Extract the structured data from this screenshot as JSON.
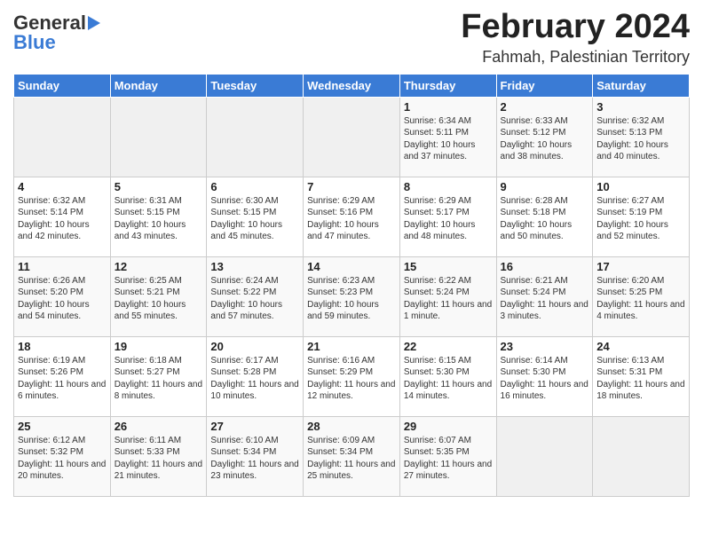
{
  "header": {
    "logo_general": "General",
    "logo_blue": "Blue",
    "month_title": "February 2024",
    "location": "Fahmah, Palestinian Territory"
  },
  "days_of_week": [
    "Sunday",
    "Monday",
    "Tuesday",
    "Wednesday",
    "Thursday",
    "Friday",
    "Saturday"
  ],
  "weeks": [
    [
      {
        "day": "",
        "content": ""
      },
      {
        "day": "",
        "content": ""
      },
      {
        "day": "",
        "content": ""
      },
      {
        "day": "",
        "content": ""
      },
      {
        "day": "1",
        "content": "Sunrise: 6:34 AM\nSunset: 5:11 PM\nDaylight: 10 hours and 37 minutes."
      },
      {
        "day": "2",
        "content": "Sunrise: 6:33 AM\nSunset: 5:12 PM\nDaylight: 10 hours and 38 minutes."
      },
      {
        "day": "3",
        "content": "Sunrise: 6:32 AM\nSunset: 5:13 PM\nDaylight: 10 hours and 40 minutes."
      }
    ],
    [
      {
        "day": "4",
        "content": "Sunrise: 6:32 AM\nSunset: 5:14 PM\nDaylight: 10 hours and 42 minutes."
      },
      {
        "day": "5",
        "content": "Sunrise: 6:31 AM\nSunset: 5:15 PM\nDaylight: 10 hours and 43 minutes."
      },
      {
        "day": "6",
        "content": "Sunrise: 6:30 AM\nSunset: 5:15 PM\nDaylight: 10 hours and 45 minutes."
      },
      {
        "day": "7",
        "content": "Sunrise: 6:29 AM\nSunset: 5:16 PM\nDaylight: 10 hours and 47 minutes."
      },
      {
        "day": "8",
        "content": "Sunrise: 6:29 AM\nSunset: 5:17 PM\nDaylight: 10 hours and 48 minutes."
      },
      {
        "day": "9",
        "content": "Sunrise: 6:28 AM\nSunset: 5:18 PM\nDaylight: 10 hours and 50 minutes."
      },
      {
        "day": "10",
        "content": "Sunrise: 6:27 AM\nSunset: 5:19 PM\nDaylight: 10 hours and 52 minutes."
      }
    ],
    [
      {
        "day": "11",
        "content": "Sunrise: 6:26 AM\nSunset: 5:20 PM\nDaylight: 10 hours and 54 minutes."
      },
      {
        "day": "12",
        "content": "Sunrise: 6:25 AM\nSunset: 5:21 PM\nDaylight: 10 hours and 55 minutes."
      },
      {
        "day": "13",
        "content": "Sunrise: 6:24 AM\nSunset: 5:22 PM\nDaylight: 10 hours and 57 minutes."
      },
      {
        "day": "14",
        "content": "Sunrise: 6:23 AM\nSunset: 5:23 PM\nDaylight: 10 hours and 59 minutes."
      },
      {
        "day": "15",
        "content": "Sunrise: 6:22 AM\nSunset: 5:24 PM\nDaylight: 11 hours and 1 minute."
      },
      {
        "day": "16",
        "content": "Sunrise: 6:21 AM\nSunset: 5:24 PM\nDaylight: 11 hours and 3 minutes."
      },
      {
        "day": "17",
        "content": "Sunrise: 6:20 AM\nSunset: 5:25 PM\nDaylight: 11 hours and 4 minutes."
      }
    ],
    [
      {
        "day": "18",
        "content": "Sunrise: 6:19 AM\nSunset: 5:26 PM\nDaylight: 11 hours and 6 minutes."
      },
      {
        "day": "19",
        "content": "Sunrise: 6:18 AM\nSunset: 5:27 PM\nDaylight: 11 hours and 8 minutes."
      },
      {
        "day": "20",
        "content": "Sunrise: 6:17 AM\nSunset: 5:28 PM\nDaylight: 11 hours and 10 minutes."
      },
      {
        "day": "21",
        "content": "Sunrise: 6:16 AM\nSunset: 5:29 PM\nDaylight: 11 hours and 12 minutes."
      },
      {
        "day": "22",
        "content": "Sunrise: 6:15 AM\nSunset: 5:30 PM\nDaylight: 11 hours and 14 minutes."
      },
      {
        "day": "23",
        "content": "Sunrise: 6:14 AM\nSunset: 5:30 PM\nDaylight: 11 hours and 16 minutes."
      },
      {
        "day": "24",
        "content": "Sunrise: 6:13 AM\nSunset: 5:31 PM\nDaylight: 11 hours and 18 minutes."
      }
    ],
    [
      {
        "day": "25",
        "content": "Sunrise: 6:12 AM\nSunset: 5:32 PM\nDaylight: 11 hours and 20 minutes."
      },
      {
        "day": "26",
        "content": "Sunrise: 6:11 AM\nSunset: 5:33 PM\nDaylight: 11 hours and 21 minutes."
      },
      {
        "day": "27",
        "content": "Sunrise: 6:10 AM\nSunset: 5:34 PM\nDaylight: 11 hours and 23 minutes."
      },
      {
        "day": "28",
        "content": "Sunrise: 6:09 AM\nSunset: 5:34 PM\nDaylight: 11 hours and 25 minutes."
      },
      {
        "day": "29",
        "content": "Sunrise: 6:07 AM\nSunset: 5:35 PM\nDaylight: 11 hours and 27 minutes."
      },
      {
        "day": "",
        "content": ""
      },
      {
        "day": "",
        "content": ""
      }
    ]
  ]
}
